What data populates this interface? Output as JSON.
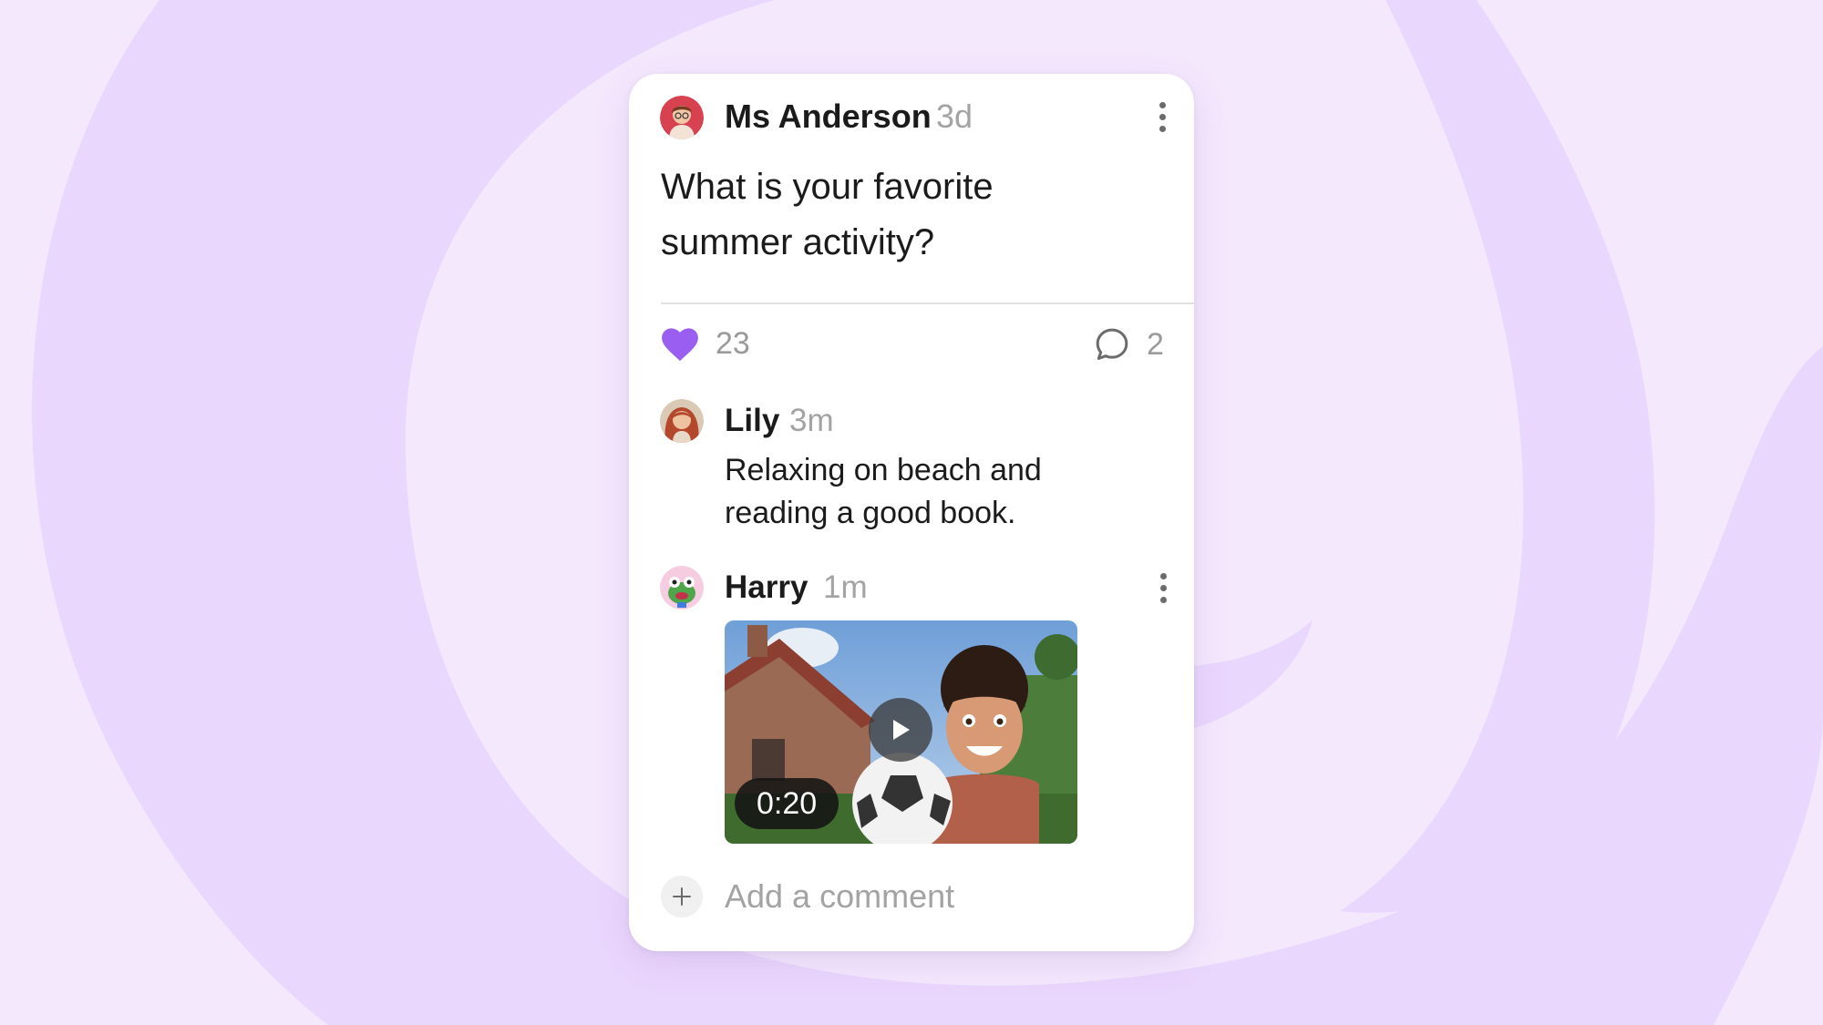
{
  "colors": {
    "background": "#f4e8fd",
    "background_shape": "#ead7fd",
    "accent_heart": "#9a5ff0",
    "card": "#ffffff",
    "text": "#1b1b1b",
    "muted": "#a3a3a3"
  },
  "post": {
    "author": "Ms Anderson",
    "time": "3d",
    "question": "What is your favorite summer activity?",
    "likes": "23",
    "comment_count": "2"
  },
  "comments": [
    {
      "author": "Lily",
      "time": "3m",
      "text": "Relaxing on beach and reading a good book."
    },
    {
      "author": "Harry",
      "time": "1m",
      "video_duration": "0:20"
    }
  ],
  "add_comment": {
    "placeholder": "Add a comment"
  },
  "icons": {
    "menu": "more-vertical-icon",
    "like": "heart-icon",
    "comment": "speech-bubble-icon",
    "play": "play-icon",
    "add": "plus-icon"
  }
}
